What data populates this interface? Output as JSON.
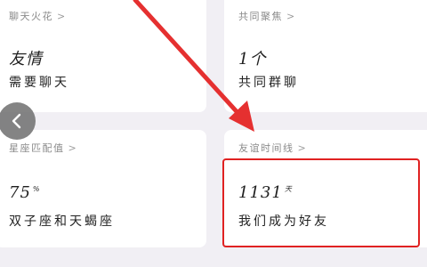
{
  "cards": {
    "chat_streak": {
      "title": "聊天火花",
      "value": "友情",
      "unit": "",
      "desc": "需要聊天"
    },
    "common_friends": {
      "title": "共同聚焦",
      "value": "1个",
      "unit": "",
      "desc": "共同群聊"
    },
    "zodiac_match": {
      "title": "星座匹配值",
      "value": "75",
      "unit": "%",
      "desc": "双子座和天蝎座"
    },
    "friendship_timeline": {
      "title": "友谊时间线",
      "value": "1131",
      "unit": "天",
      "desc": "我们成为好友"
    }
  },
  "icons": {
    "back": "chevron-left-icon",
    "title_chevron": "chevron-right-icon"
  },
  "colors": {
    "highlight": "#e02222",
    "arrow": "#e53030",
    "card_bg": "#ffffff",
    "page_bg": "#f1eff4"
  }
}
